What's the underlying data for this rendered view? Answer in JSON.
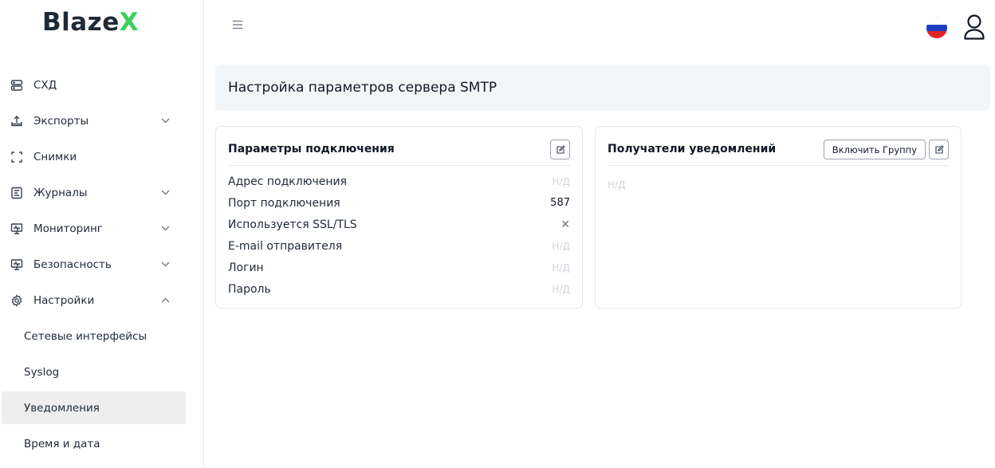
{
  "brand": {
    "name_main": "Blaze",
    "name_accent": "X"
  },
  "sidebar": {
    "items": [
      {
        "label": "СХД",
        "icon": "storage-icon"
      },
      {
        "label": "Экспорты",
        "icon": "export-icon"
      },
      {
        "label": "Снимки",
        "icon": "snapshot-icon"
      },
      {
        "label": "Журналы",
        "icon": "journal-icon"
      },
      {
        "label": "Мониторинг",
        "icon": "monitor-icon"
      },
      {
        "label": "Безопасность",
        "icon": "security-icon"
      },
      {
        "label": "Настройки",
        "icon": "gear-icon"
      }
    ],
    "subitems": [
      {
        "label": "Сетевые интерфейсы"
      },
      {
        "label": "Syslog"
      },
      {
        "label": "Уведомления",
        "active": true
      },
      {
        "label": "Время и дата"
      }
    ]
  },
  "header": {
    "title": "Настройка параметров сервера SMTP"
  },
  "connection": {
    "title": "Параметры подключения",
    "rows": [
      {
        "key": "Адрес подключения",
        "value": "Н/Д"
      },
      {
        "key": "Порт подключения",
        "value": "587"
      },
      {
        "key": "Используется SSL/TLS",
        "value": "✕"
      },
      {
        "key": "E-mail отправителя",
        "value": "Н/Д"
      },
      {
        "key": "Логин",
        "value": "Н/Д"
      },
      {
        "key": "Пароль",
        "value": "Н/Д"
      }
    ]
  },
  "recipients": {
    "title": "Получатели уведомлений",
    "enable_group_label": "Включить Группу",
    "empty_value": "Н/Д"
  },
  "colors": {
    "brand_accent": "#3ccf5a",
    "header_bg": "#f3f6f9",
    "active_bg": "#eeeeee"
  },
  "language": {
    "flag": "ru-flag-icon"
  }
}
